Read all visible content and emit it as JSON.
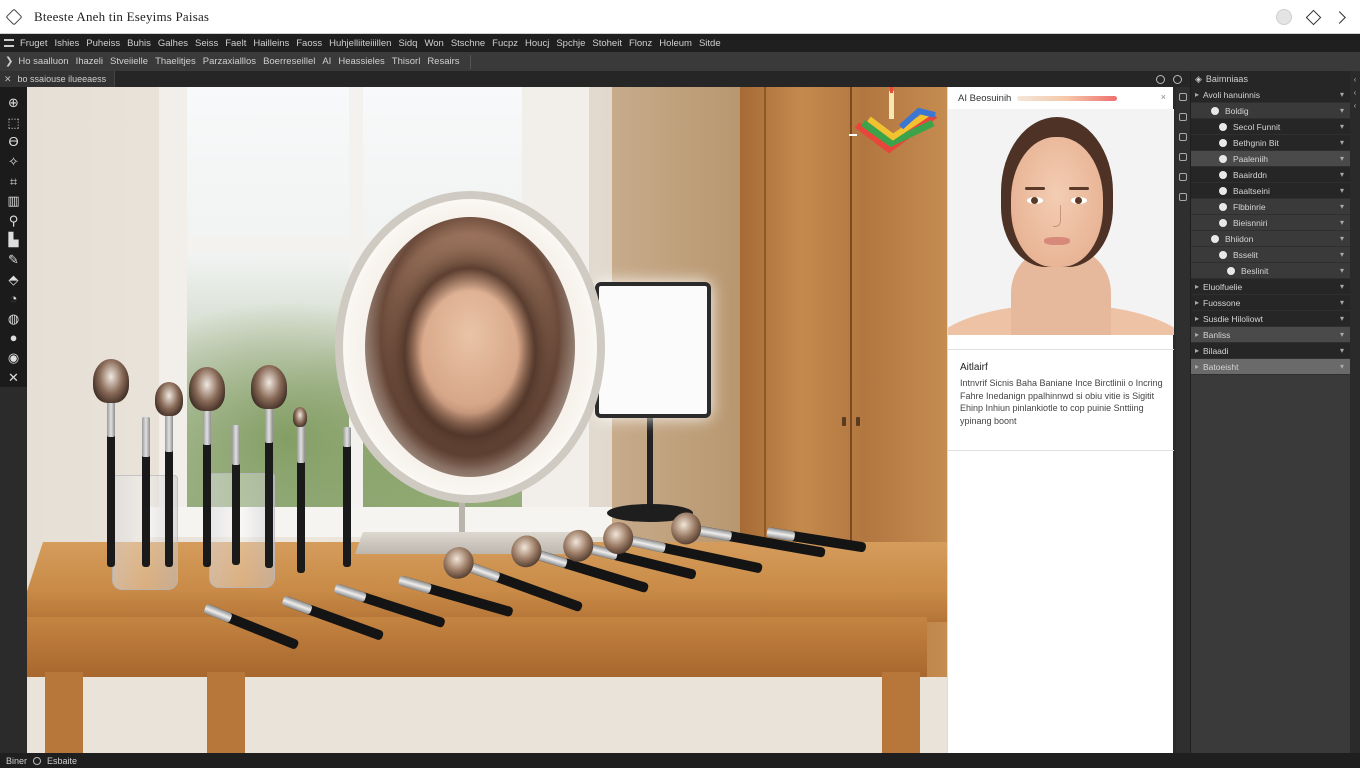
{
  "titlebar": {
    "title": "Bteeste Aneh tin Eseyims Paisas",
    "app_icon": "diamond-icon",
    "right_icons": [
      "account-circle-icon",
      "diamond-icon",
      "chevron-right-icon"
    ]
  },
  "menubar": {
    "items": [
      "Fruget",
      "Ishies",
      "Puheiss",
      "Buhis",
      "Galhes",
      "Seiss",
      "Faelt",
      "Hailleins",
      "Faoss",
      "Huhjelliiteiiillen",
      "Sidq",
      "Won",
      "Stschne",
      "Fucpz",
      "Houcj",
      "Spchje",
      "Stoheit",
      "Flonz",
      "Holeum",
      "Sitde"
    ]
  },
  "optbar": {
    "items": [
      "Ho saalluon",
      "Ihazeli",
      "Stveiielle",
      "Thaelitjes",
      "Parzaxialllos",
      "Boerreseillel",
      "AI",
      "Heassieles",
      "Thisorl",
      "Resairs"
    ]
  },
  "tabbar": {
    "tab_label": "bo ssaiouse ilueeaess",
    "right_icons": [
      "circle-icon",
      "cloud-icon"
    ]
  },
  "toolbar": {
    "tools": [
      "move-icon",
      "marquee-icon",
      "lasso-icon",
      "magic-wand-icon",
      "crop-icon",
      "frame-icon",
      "eyedropper-icon",
      "healing-brush-icon",
      "brush-icon",
      "clone-stamp-icon",
      "eraser-icon",
      "gradient-icon",
      "dodge-icon",
      "pen-icon",
      "type-icon"
    ]
  },
  "ai_panel": {
    "header_label": "AI Beosuinih",
    "close": "×",
    "text_title": "Aitlairf",
    "text_body": "Intnvrif Sicnis Baha Baniane Ince Birctlinii o Incring Fahre Inedanign ppalhinnwd si obiu vitie is Sigitit Ehinp Inhiun pinlankiotle to cop puinie Snttiing ypinang boont"
  },
  "layers": {
    "header_label": "Baimniaas",
    "rows": [
      {
        "label": "Avoli hanuinnis",
        "style": "dark",
        "indent": 0,
        "dot": false
      },
      {
        "label": "Boldig",
        "style": "",
        "indent": 1,
        "dot": true
      },
      {
        "label": "Secol Funnit",
        "style": "dark",
        "indent": 2,
        "dot": true
      },
      {
        "label": "Bethgnin Bit",
        "style": "dark",
        "indent": 2,
        "dot": true
      },
      {
        "label": "Paaleniih",
        "style": "sel",
        "indent": 2,
        "dot": true
      },
      {
        "label": "Baairddn",
        "style": "dark",
        "indent": 2,
        "dot": true
      },
      {
        "label": "Baaltseini",
        "style": "dark",
        "indent": 2,
        "dot": true
      },
      {
        "label": "Flbbinrie",
        "style": "",
        "indent": 2,
        "dot": true
      },
      {
        "label": "Bieisnniri",
        "style": "",
        "indent": 2,
        "dot": true
      },
      {
        "label": "Bhiidon",
        "style": "",
        "indent": 1,
        "dot": true
      },
      {
        "label": "Bsselit",
        "style": "",
        "indent": 2,
        "dot": true
      },
      {
        "label": "Beslinit",
        "style": "",
        "indent": 3,
        "dot": true
      },
      {
        "label": "Eluolfuelie",
        "style": "dark",
        "indent": 0,
        "dot": false
      },
      {
        "label": "Fuossone",
        "style": "dark",
        "indent": 0,
        "dot": false
      },
      {
        "label": "Susdie Hiloliowt",
        "style": "dark",
        "indent": 0,
        "dot": false
      },
      {
        "label": "Banliss",
        "style": "sel",
        "indent": 0,
        "dot": false
      },
      {
        "label": "Bilaadi",
        "style": "dark",
        "indent": 0,
        "dot": false
      },
      {
        "label": "Batoeisht",
        "style": "sel2",
        "indent": 0,
        "dot": false
      }
    ]
  },
  "statusbar": {
    "left_label": "Biner",
    "right_label": "Esbaite"
  },
  "colors": {
    "app_bg": "#2b2b2b",
    "panel": "#3a3a3a",
    "menubar": "#1f1f1f",
    "accent_slider_end": "#ef6f6f"
  }
}
